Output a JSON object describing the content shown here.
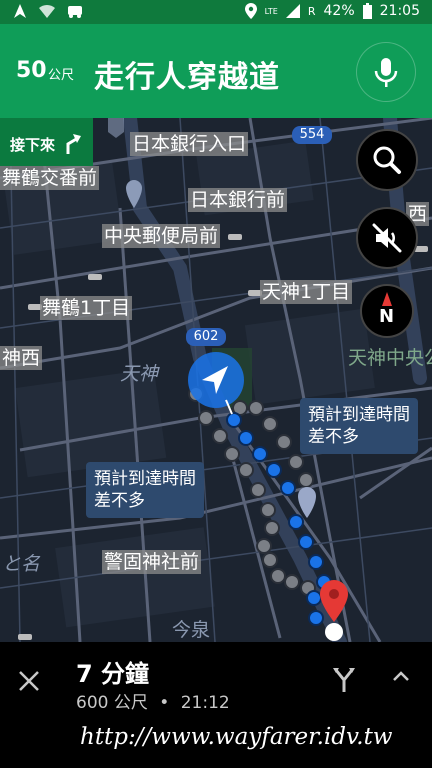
{
  "status": {
    "lte": "LTE",
    "roaming": "R",
    "battery": "42%",
    "time": "21:05"
  },
  "header": {
    "distance": "50",
    "distance_unit": "公尺",
    "street": "走行人穿越道"
  },
  "next_turn": {
    "label": "接下來"
  },
  "map": {
    "labels": {
      "nihon_ginko_entrance": "日本銀行入口",
      "maizuru_koban": "舞鶴交番前",
      "nihon_ginko_mae": "日本銀行前",
      "chuo_post": "中央郵便局前",
      "maizuru_1": "舞鶴1丁目",
      "tenjin_1": "天神1丁目",
      "tenjin_nishi": "神西",
      "tenjin": "天神",
      "tenjin_chuo": "天神中央公",
      "keigo": "警固神社前",
      "imaizumi": "今泉",
      "nishi": "西",
      "left_edge": "と名"
    },
    "road_badges": {
      "r554": "554",
      "r602": "602"
    },
    "eta_bubbles": [
      {
        "line1": "預計到達時間",
        "line2": "差不多"
      },
      {
        "line1": "預計到達時間",
        "line2": "差不多"
      }
    ],
    "compass": "N"
  },
  "trip": {
    "duration": "7 分鐘",
    "distance": "600 公尺",
    "separator": "•",
    "arrival": "21:12"
  },
  "watermark": "http://www.wayfarer.idv.tw",
  "colors": {
    "nav_green": "#0f9d58",
    "route_blue": "#1a73e8",
    "map_bg": "#1c2430"
  }
}
